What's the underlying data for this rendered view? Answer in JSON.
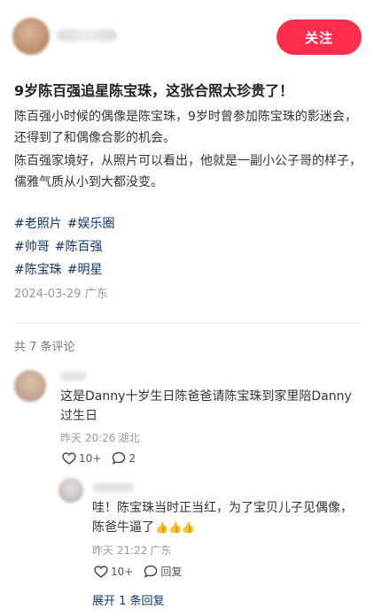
{
  "header": {
    "follow_label": "关注"
  },
  "post": {
    "title": "9岁陈百强追星陈宝珠，这张合照太珍贵了！",
    "paragraphs": [
      "陈百强小时候的偶像是陈宝珠，9岁时曾参加陈宝珠的影迷会，还得到了和偶像合影的机会。",
      "陈百强家境好，从照片可以看出，他就是一副小公子哥的样子，儒雅气质从小到大都没变。"
    ],
    "tags": [
      "#老照片",
      "#娱乐圈",
      "#帅哥",
      "#陈百强",
      "#陈宝珠",
      "#明星"
    ],
    "date": "2024-03-29",
    "location": "广东"
  },
  "comments_header": "共 7 条评论",
  "comments": [
    {
      "text": "这是Danny十岁生日陈爸爸请陈宝珠到家里陪Danny过生日",
      "time": "昨天 20:26",
      "location": "湖北",
      "likes": "10+",
      "replies": "2"
    }
  ],
  "reply": {
    "text": "哇！陈宝珠当时正当红，为了宝贝儿子见偶像，陈爸牛逼了",
    "emoji": "👍👍👍",
    "time": "昨天 21:22",
    "location": "广东",
    "likes": "10+",
    "reply_label": "回复"
  },
  "expand_label": "展开 1 条回复",
  "colors": {
    "accent": "#ff2e4d",
    "tag": "#13386c",
    "muted": "#999999"
  }
}
